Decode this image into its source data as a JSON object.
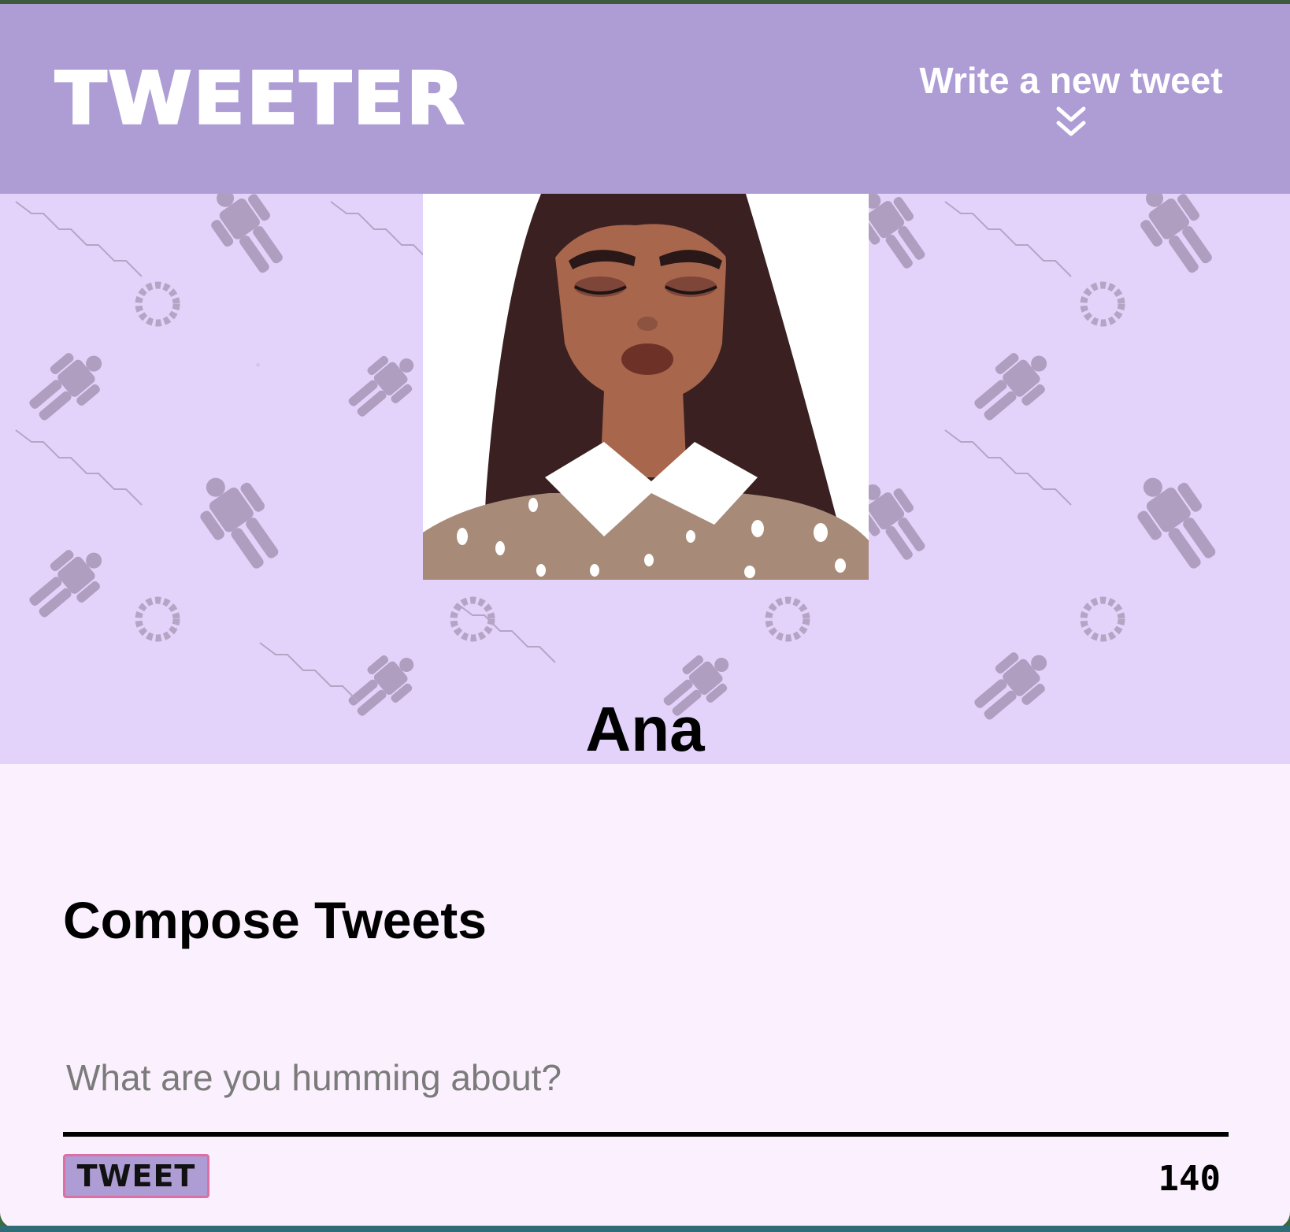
{
  "nav": {
    "logo": "TWEETER",
    "write_link": "Write a new tweet",
    "chevron_icon": "double-chevron-down-icon"
  },
  "profile": {
    "name": "Ana",
    "avatar_icon": "user-avatar-illustration"
  },
  "compose": {
    "title": "Compose Tweets",
    "placeholder": "What are you humming about?",
    "button_label": "TWEET",
    "counter": "140"
  },
  "colors": {
    "nav_bg": "#ae9cd5",
    "banner_bg": "#e3d3fb",
    "page_bg": "#fbf0fd",
    "button_border": "#dc6fa3"
  }
}
